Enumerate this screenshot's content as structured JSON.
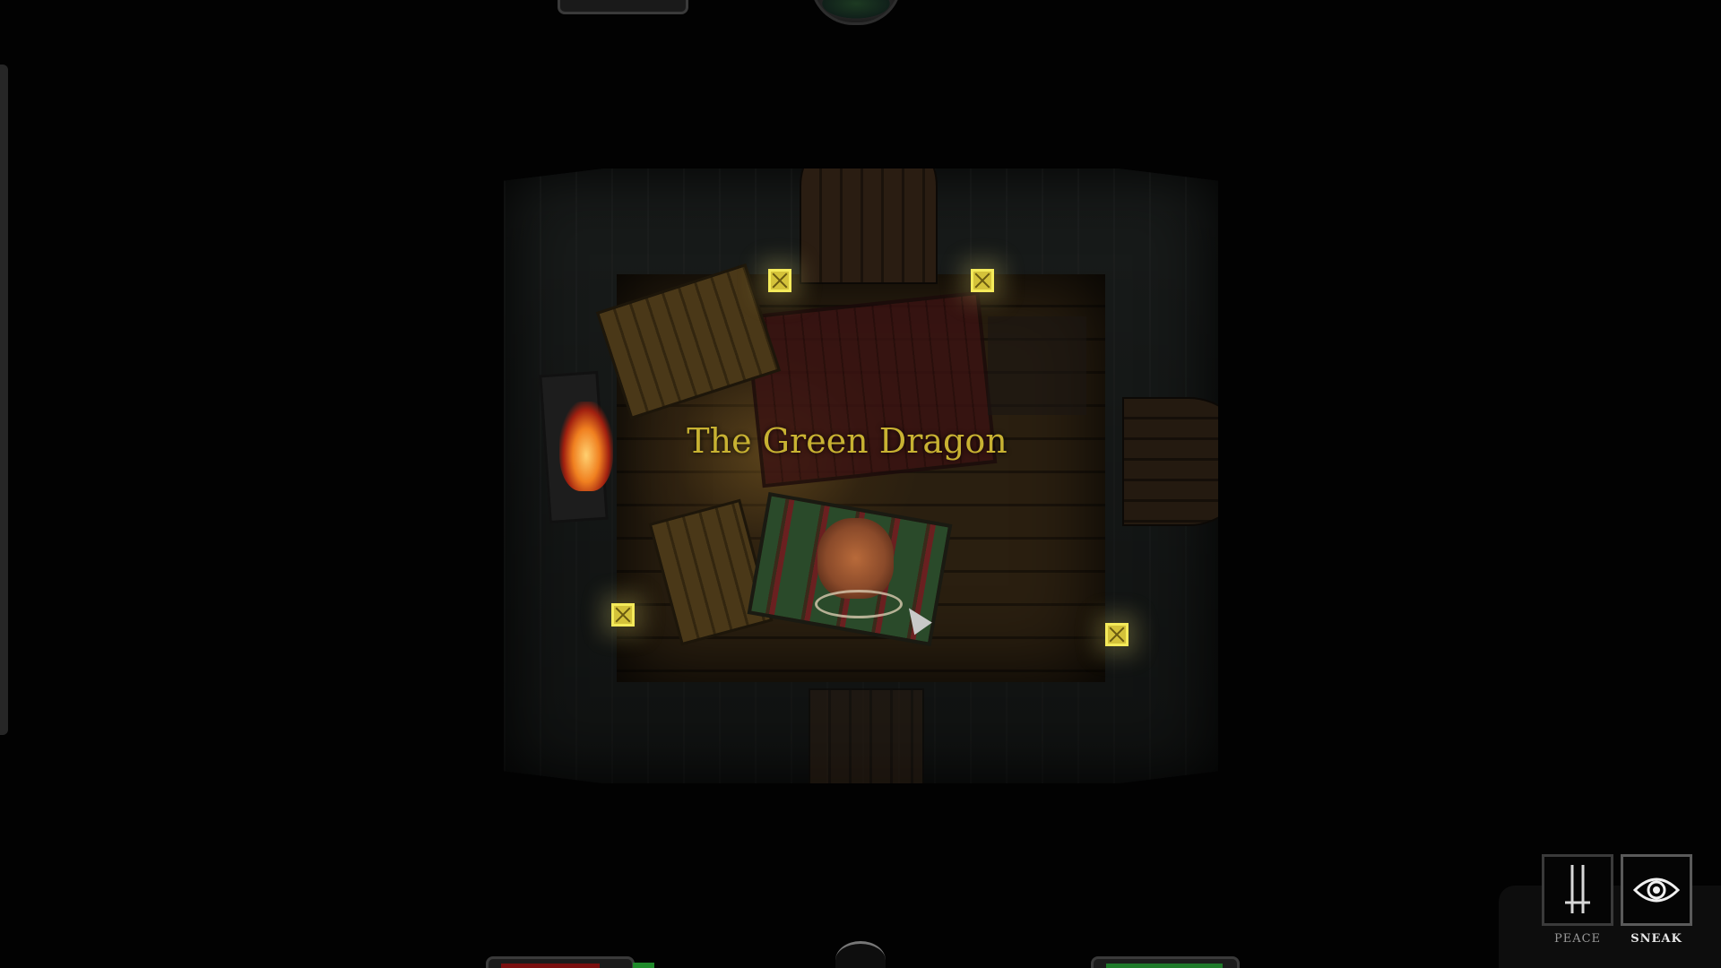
{
  "location": {
    "room_name": "The Green Dragon"
  },
  "modes": {
    "peace": {
      "label": "PEACE",
      "icon": "crossed-swords-icon",
      "active": false
    },
    "sneak": {
      "label": "SNEAK",
      "icon": "eye-icon",
      "active": true
    }
  },
  "colors": {
    "title": "#c8b232",
    "health": "#7a1010",
    "stamina": "#1f7a2a",
    "lantern": "#d4c23a"
  }
}
